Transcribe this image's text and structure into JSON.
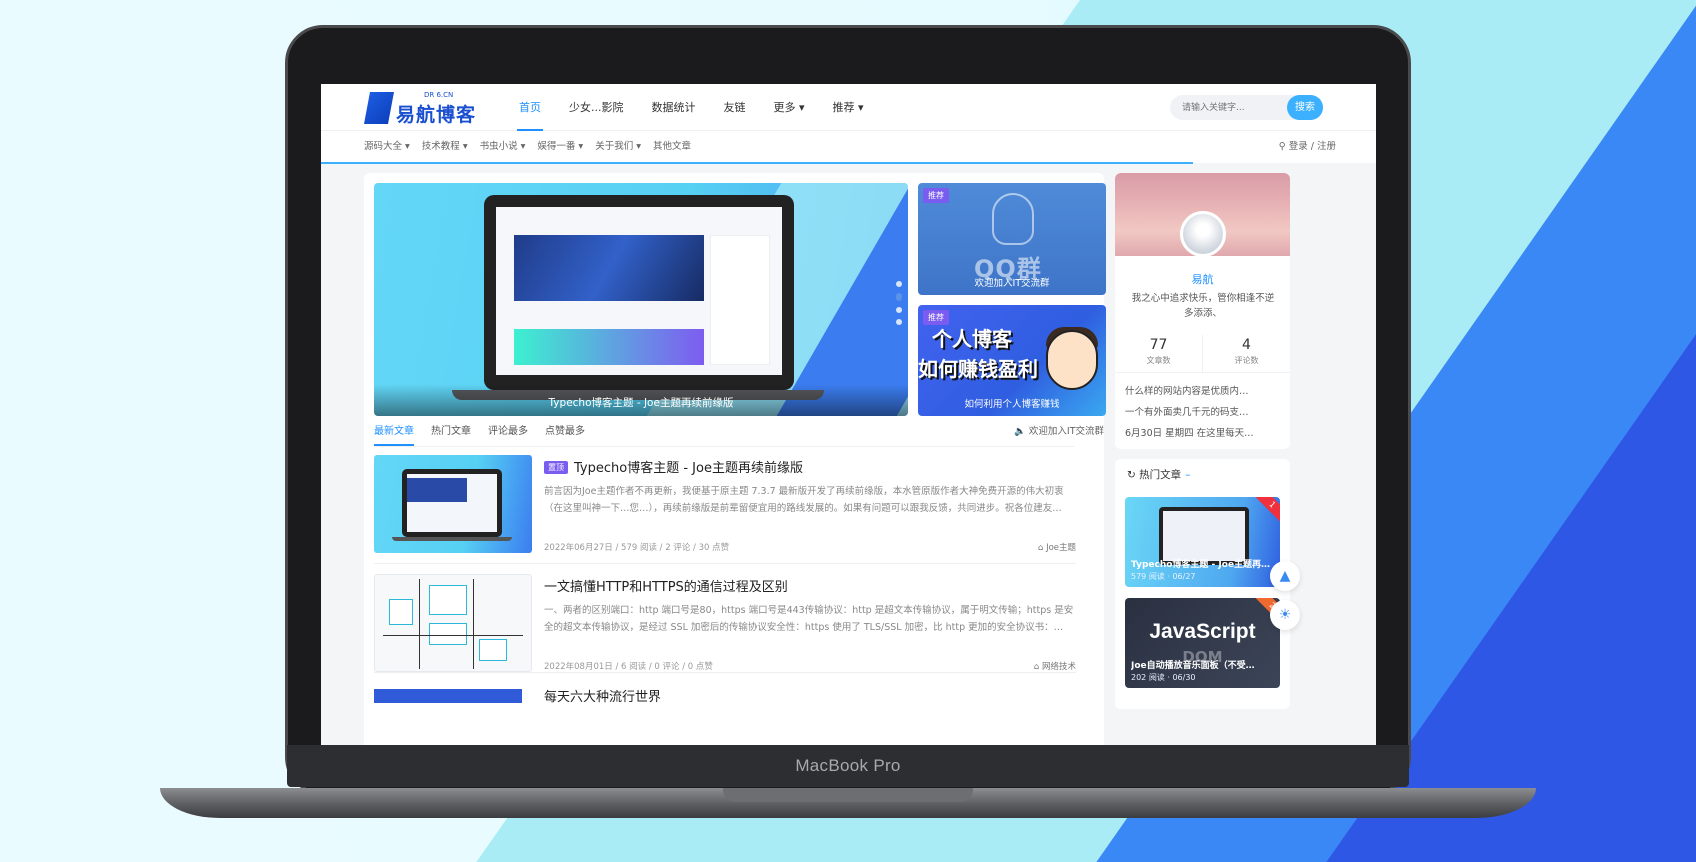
{
  "device_label": "MacBook Pro",
  "site": {
    "logo_text": "易航博客",
    "logo_sub": "DR 6.CN",
    "nav": [
      {
        "label": "首页",
        "active": true
      },
      {
        "label": "少女...影院"
      },
      {
        "label": "数据统计"
      },
      {
        "label": "友链"
      },
      {
        "label": "更多 ▾"
      },
      {
        "label": "推荐 ▾"
      }
    ],
    "search_placeholder": "请输入关键字...",
    "search_button": "搜索",
    "subnav": [
      "源码大全 ▾",
      "技术教程 ▾",
      "书虫小说 ▾",
      "娱得一番 ▾",
      "关于我们 ▾",
      "其他文章"
    ],
    "login": "登录 / 注册"
  },
  "hero": {
    "caption": "Typecho博客主题 - Joe主题再续前缘版",
    "qq_tag": "推荐",
    "qq_big": "QQ群",
    "qq_caption": "欢迎加入IT交流群",
    "blog_tag": "推荐",
    "blog_big1": "个人博客",
    "blog_big2": "如何赚钱盈利",
    "blog_caption": "如何利用个人博客赚钱"
  },
  "tabs": {
    "items": [
      "最新文章",
      "热门文章",
      "评论最多",
      "点赞最多"
    ],
    "active": 0,
    "notice": "欢迎加入IT交流群"
  },
  "posts": [
    {
      "badge": "置顶",
      "title": "Typecho博客主题 - Joe主题再续前缘版",
      "excerpt": "前言因为Joe主题作者不再更新，我便基于原主题 7.3.7 最新版开发了再续前缘版，本水管原版作者大神免费开源的伟大初衷（在这里叫神一下…您…），再续前缘版是前辈留便宜用的路线发展的。如果有问题可以跟我反馈，共同进步。祝各位建友…",
      "meta": "2022年06月27日 / 579 阅读 / 2 评论 / 30 点赞",
      "category": "Joe主题"
    },
    {
      "badge": "",
      "title": "一文搞懂HTTP和HTTPS的通信过程及区别",
      "excerpt": "一、两者的区别端口：http 端口号是80，https 端口号是443传输协议：http 是超文本传输协议，属于明文传输；https 是安全的超文本传输协议，是经过 SSL 加密后的传输协议安全性：https 使用了 TLS/SSL 加密，比 http 更加的安全协议书：…",
      "meta": "2022年08月01日 / 6 阅读 / 0 评论 / 0 点赞",
      "category": "网络技术"
    }
  ],
  "peek_title": "每天六大种流行世界",
  "profile": {
    "name": "易航",
    "bio": "我之心中追求快乐，管你相逢不逆多添添、",
    "articles": "77",
    "articles_label": "文章数",
    "comments": "4",
    "comments_label": "评论数",
    "links": [
      "什么样的网站内容是优质内…",
      "一个有外面卖几千元的码支…",
      "6月30日 星期四 在这里每天…"
    ]
  },
  "hot": {
    "heading": "热门文章",
    "cards": [
      {
        "title": "Typecho博客主题 - Joe主题再…",
        "meta": "579 阅读 · 06/27",
        "rank": "1"
      },
      {
        "title": "Joe自动播放音乐面板（不受…",
        "meta": "202 阅读 · 06/30",
        "rank": "2",
        "big": "JavaScript",
        "sub": "DOM"
      }
    ]
  },
  "colors": {
    "accent": "#1e90ff",
    "logo": "#1a4fd0",
    "badge": "#7a5cf0"
  }
}
